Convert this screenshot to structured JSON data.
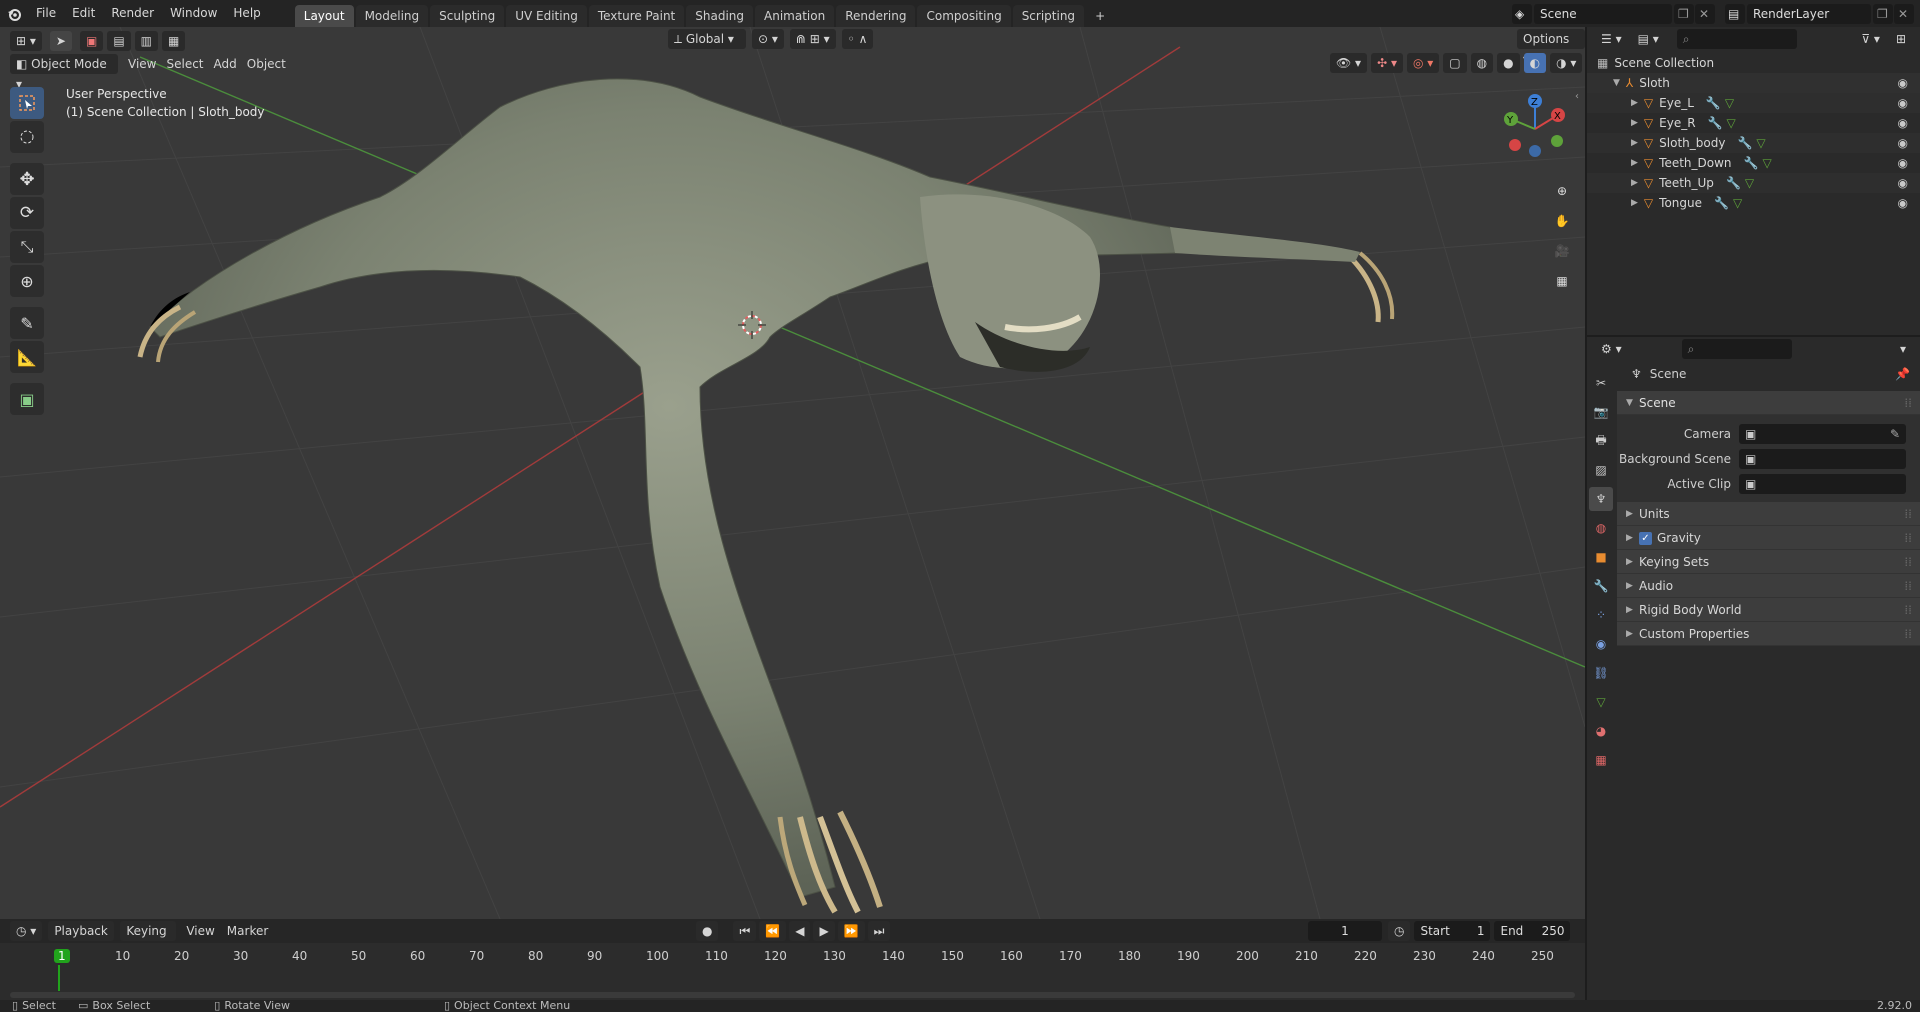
{
  "topbar": {
    "menus": [
      "File",
      "Edit",
      "Render",
      "Window",
      "Help"
    ],
    "workspaces": [
      "Layout",
      "Modeling",
      "Sculpting",
      "UV Editing",
      "Texture Paint",
      "Shading",
      "Animation",
      "Rendering",
      "Compositing",
      "Scripting"
    ],
    "active_workspace": "Layout",
    "add_tab": "+",
    "scene_name": "Scene",
    "view_layer": "RenderLayer"
  },
  "viewport": {
    "mode": "Object Mode",
    "menus": [
      "View",
      "Select",
      "Add",
      "Object"
    ],
    "transform_orientation": "Global",
    "options_label": "Options",
    "overlay_title": "User Perspective",
    "overlay_subtitle": "(1) Scene Collection | Sloth_body",
    "gizmo_axes": [
      "X",
      "Y",
      "Z"
    ]
  },
  "outliner": {
    "root": "Scene Collection",
    "collection": "Sloth",
    "items": [
      {
        "name": "Eye_L"
      },
      {
        "name": "Eye_R"
      },
      {
        "name": "Sloth_body"
      },
      {
        "name": "Teeth_Down"
      },
      {
        "name": "Teeth_Up"
      },
      {
        "name": "Tongue"
      }
    ]
  },
  "properties": {
    "context": "Scene",
    "panel": "Scene",
    "fields": [
      {
        "label": "Camera",
        "value": ""
      },
      {
        "label": "Background Scene",
        "value": ""
      },
      {
        "label": "Active Clip",
        "value": ""
      }
    ],
    "subpanels": [
      {
        "label": "Units",
        "checkbox": false
      },
      {
        "label": "Gravity",
        "checkbox": true
      },
      {
        "label": "Keying Sets",
        "checkbox": false
      },
      {
        "label": "Audio",
        "checkbox": false
      },
      {
        "label": "Rigid Body World",
        "checkbox": false
      },
      {
        "label": "Custom Properties",
        "checkbox": false
      }
    ]
  },
  "timeline": {
    "menus": [
      "Playback",
      "Keying",
      "View",
      "Marker"
    ],
    "current_frame": "1",
    "start_label": "Start",
    "start_value": "1",
    "end_label": "End",
    "end_value": "250",
    "ruler": [
      "1",
      "10",
      "20",
      "30",
      "40",
      "50",
      "60",
      "70",
      "80",
      "90",
      "100",
      "110",
      "120",
      "130",
      "140",
      "150",
      "160",
      "170",
      "180",
      "190",
      "200",
      "210",
      "220",
      "230",
      "240",
      "250"
    ]
  },
  "statusbar": {
    "select": "Select",
    "box_select": "Box Select",
    "rotate_view": "Rotate View",
    "context_menu": "Object Context Menu",
    "version": "2.92.0"
  },
  "colors": {
    "accent": "#4772b3",
    "active_frame": "#21a31c",
    "axis_x": "#c23838",
    "axis_y": "#5ea23a",
    "object_orange": "#e88c30"
  }
}
